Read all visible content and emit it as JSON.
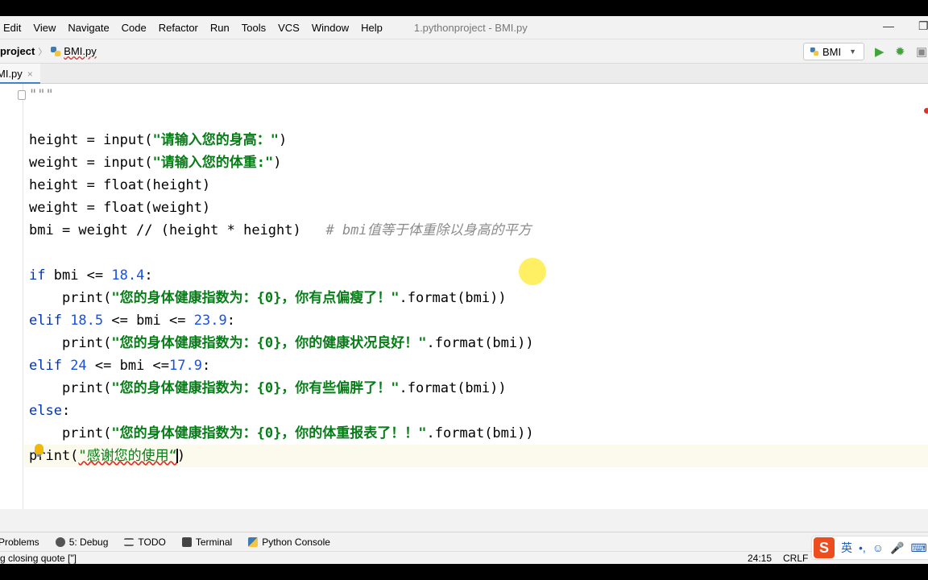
{
  "menu": {
    "items": [
      "Edit",
      "View",
      "Navigate",
      "Code",
      "Refactor",
      "Run",
      "Tools",
      "VCS",
      "Window",
      "Help"
    ],
    "window_title": "1.pythonproject - BMI.py"
  },
  "nav": {
    "project": "nproject",
    "separator": "〉",
    "file": "BMI.py",
    "run_config": "BMI"
  },
  "tab": {
    "label": "MI.py",
    "close": "×"
  },
  "code": {
    "line1": "\"\"\"",
    "line3_a": "height = ",
    "line3_b": "input(",
    "line3_c": "\"请输入您的身高：\"",
    "line3_d": ")",
    "line4_a": "weight = ",
    "line4_b": "input(",
    "line4_c": "\"请输入您的体重:\"",
    "line4_d": ")",
    "line5": "height = float(height)",
    "line6": "weight = float(weight)",
    "line7_a": "bmi = weight // (height * height)   ",
    "line7_b": "# bmi值等于体重除以身高的平方",
    "line9_kw": "if",
    "line9_a": " bmi <= ",
    "line9_num": "18.4",
    "line9_b": ":",
    "line10_a": "    print(",
    "line10_s": "\"您的身体健康指数为：{0}，你有点偏瘦了！\"",
    "line10_b": ".format(bmi))",
    "line11_kw": "elif",
    "line11_num1": " 18.5",
    "line11_a": " <= bmi <= ",
    "line11_num2": "23.9",
    "line11_b": ":",
    "line12_a": "    print(",
    "line12_s": "\"您的身体健康指数为：{0}，你的健康状况良好！\"",
    "line12_b": ".format(bmi))",
    "line13_kw": "elif",
    "line13_num1": " 24",
    "line13_a": " <= bmi <=",
    "line13_num2": "17.9",
    "line13_b": ":",
    "line14_a": "    print(",
    "line14_s": "\"您的身体健康指数为：{0}，你有些偏胖了！\"",
    "line14_b": ".format(bmi))",
    "line15_kw": "else",
    "line15_b": ":",
    "line16_a": "    print(",
    "line16_s": "\"您的身体健康指数为：{0}，你的体重报表了！！\"",
    "line16_b": ".format(bmi))",
    "line17_a": "print(",
    "line17_s": "\"感谢您的使用“",
    "line17_b": ")"
  },
  "tool_windows": {
    "problems": "Problems",
    "debug": "5: Debug",
    "todo": "TODO",
    "terminal": "Terminal",
    "python_console": "Python Console"
  },
  "status": {
    "message": "g closing quote [\"]",
    "position": "24:15",
    "line_sep": "CRLF"
  },
  "ime": {
    "logo": "S",
    "lang": "英"
  }
}
